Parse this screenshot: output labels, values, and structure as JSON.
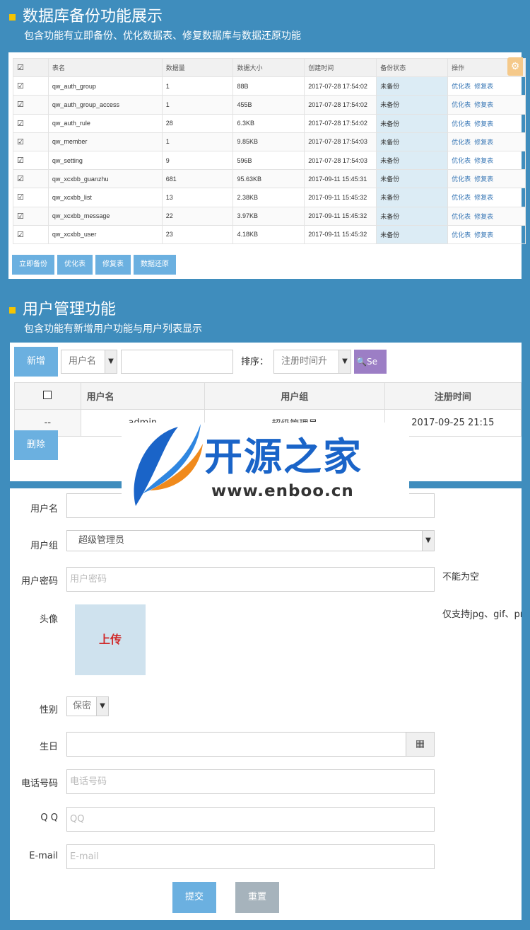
{
  "section1": {
    "title": "数据库备份功能展示",
    "subtitle": "包含功能有立即备份、优化数据表、修复数据库与数据还原功能",
    "columns": [
      "☑",
      "表名",
      "数据量",
      "数据大小",
      "创建时间",
      "备份状态",
      "操作"
    ],
    "rows": [
      {
        "name": "qw_auth_group",
        "count": "1",
        "size": "88B",
        "created": "2017-07-28 17:54:02",
        "status": "未备份"
      },
      {
        "name": "qw_auth_group_access",
        "count": "1",
        "size": "455B",
        "created": "2017-07-28 17:54:02",
        "status": "未备份"
      },
      {
        "name": "qw_auth_rule",
        "count": "28",
        "size": "6.3KB",
        "created": "2017-07-28 17:54:02",
        "status": "未备份"
      },
      {
        "name": "qw_member",
        "count": "1",
        "size": "9.85KB",
        "created": "2017-07-28 17:54:03",
        "status": "未备份"
      },
      {
        "name": "qw_setting",
        "count": "9",
        "size": "596B",
        "created": "2017-07-28 17:54:03",
        "status": "未备份"
      },
      {
        "name": "qw_xcxbb_guanzhu",
        "count": "681",
        "size": "95.63KB",
        "created": "2017-09-11 15:45:31",
        "status": "未备份"
      },
      {
        "name": "qw_xcxbb_list",
        "count": "13",
        "size": "2.38KB",
        "created": "2017-09-11 15:45:32",
        "status": "未备份"
      },
      {
        "name": "qw_xcxbb_message",
        "count": "22",
        "size": "3.97KB",
        "created": "2017-09-11 15:45:32",
        "status": "未备份"
      },
      {
        "name": "qw_xcxbb_user",
        "count": "23",
        "size": "4.18KB",
        "created": "2017-09-11 15:45:32",
        "status": "未备份"
      }
    ],
    "op_optimize": "优化表",
    "op_repair": "修复表",
    "buttons": [
      "立即备份",
      "优化表",
      "修复表",
      "数据还原"
    ]
  },
  "section2": {
    "title": "用户管理功能",
    "subtitle": "包含功能有新增用户功能与用户列表显示",
    "new_label": "新增",
    "filter_select": "用户名",
    "sort_label": "排序：",
    "sort_select": "注册时间升",
    "search_label": "Se",
    "columns": [
      "用户名",
      "用户组",
      "注册时间"
    ],
    "row": {
      "id": "--",
      "username": "admin",
      "group": "超级管理员",
      "registered": "2017-09-25 21:15"
    },
    "delete_label": "删除"
  },
  "logo": {
    "brand": "开源之家",
    "url": "www.enboo.cn"
  },
  "form": {
    "username_label": "用户名",
    "group_label": "用户组",
    "group_value": "超级管理员",
    "password_label": "用户密码",
    "password_placeholder": "用户密码",
    "password_hint": "不能为空",
    "avatar_label": "头像",
    "upload_label": "上传",
    "avatar_hint": "仅支持jpg、gif、png",
    "gender_label": "性别",
    "gender_value": "保密",
    "birthday_label": "生日",
    "phone_label": "电话号码",
    "phone_placeholder": "电话号码",
    "qq_label": "Q Q",
    "qq_placeholder": "QQ",
    "email_label": "E-mail",
    "email_placeholder": "E-mail",
    "submit_label": "提交",
    "reset_label": "重置"
  },
  "colors": {
    "background": "#3f8dbd",
    "button": "#6bb0e0",
    "accent_square": "#f5c400",
    "search": "#9c7ec5"
  }
}
